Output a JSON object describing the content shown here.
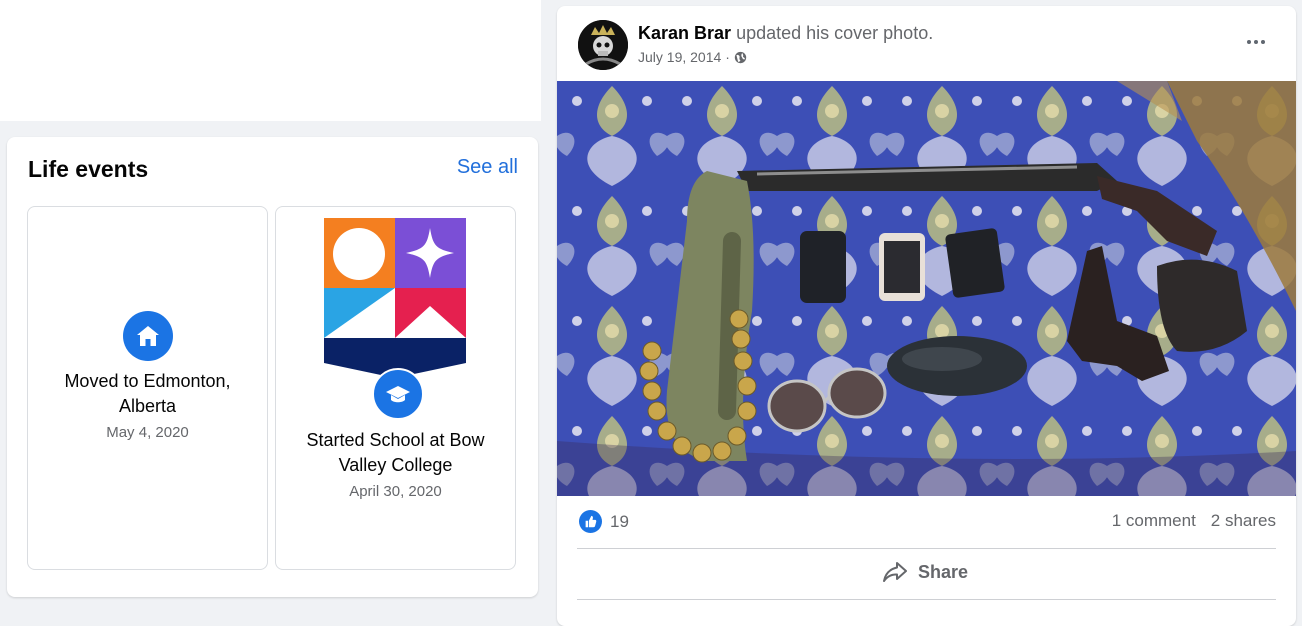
{
  "life_events": {
    "title": "Life events",
    "see_all_label": "See all",
    "events": [
      {
        "text": "Moved to Edmonton, Alberta",
        "date": "May 4, 2020",
        "icon": "home-icon"
      },
      {
        "text": "Started School at Bow Valley College",
        "date": "April 30, 2020",
        "icon": "graduation-cap-icon"
      }
    ]
  },
  "post": {
    "author": "Karan Brar",
    "action": "updated his cover photo.",
    "date": "July 19, 2014",
    "separator": "·",
    "privacy_icon": "globe-icon",
    "reaction_count": "19",
    "comments": "1 comment",
    "shares": "2 shares",
    "share_label": "Share"
  },
  "colors": {
    "accent": "#1b74e4",
    "link": "#216fdb",
    "muted_text": "#65676b",
    "background": "#f0f2f5"
  }
}
